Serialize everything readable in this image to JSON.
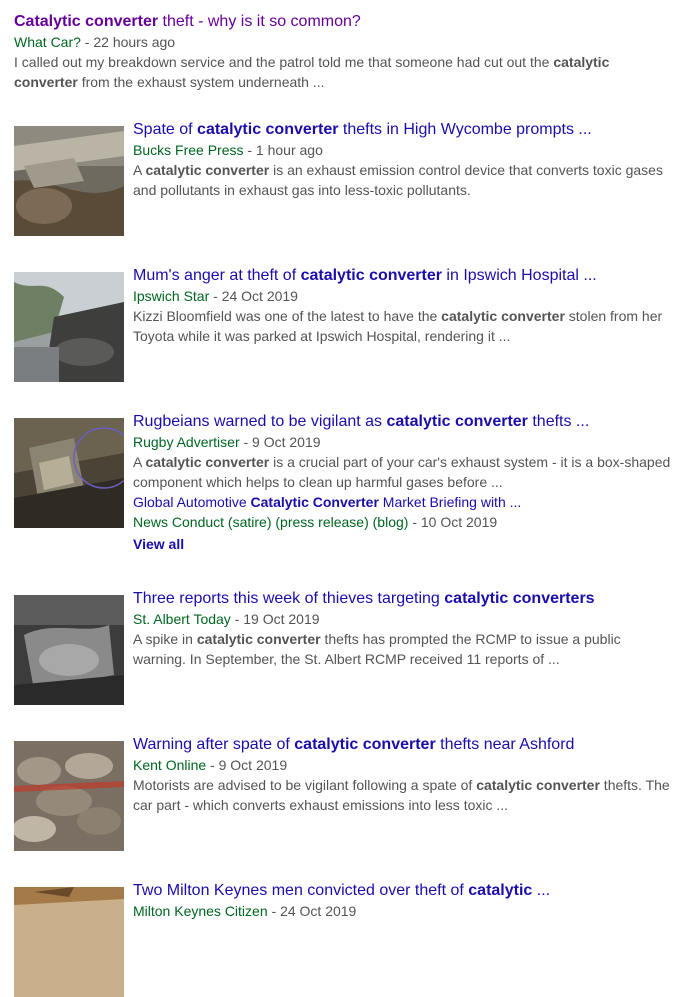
{
  "results": [
    {
      "title": [
        {
          "t": "Catalytic converter",
          "b": true
        },
        {
          "t": " theft - why is it so common?",
          "b": false
        }
      ],
      "source": "What Car?",
      "time": " - 22 hours ago",
      "snippet": [
        {
          "t": "I called out my breakdown service and the patrol told me that someone had cut out the ",
          "b": false
        },
        {
          "t": "catalytic converter",
          "b": true
        },
        {
          "t": " from the exhaust system underneath ...",
          "b": false
        }
      ],
      "thumbnail": ""
    },
    {
      "title": [
        {
          "t": "Spate of ",
          "b": false
        },
        {
          "t": "catalytic converter",
          "b": true
        },
        {
          "t": " thefts in High Wycombe prompts ...",
          "b": false
        }
      ],
      "source": "Bucks Free Press",
      "time": " - 1 hour ago",
      "snippet": [
        {
          "t": "A ",
          "b": false
        },
        {
          "t": "catalytic converter",
          "b": true
        },
        {
          "t": " is an exhaust emission control device that converts toxic gases and pollutants in exhaust gas into less-toxic pollutants.",
          "b": false
        }
      ],
      "thumbnail": "exhaust-pipe-photo"
    },
    {
      "title": [
        {
          "t": "Mum's anger at theft of ",
          "b": false
        },
        {
          "t": "catalytic converter",
          "b": true
        },
        {
          "t": " in Ipswich Hospital ...",
          "b": false
        }
      ],
      "source": "Ipswich Star",
      "time": " - 24 Oct 2019",
      "snippet": [
        {
          "t": "Kizzi Bloomfield was one of the latest to have the ",
          "b": false
        },
        {
          "t": "catalytic converter",
          "b": true
        },
        {
          "t": " stolen from her Toyota while it was parked at Ipswich Hospital, rendering it ...",
          "b": false
        }
      ],
      "thumbnail": "car-underside-photo"
    },
    {
      "title": [
        {
          "t": "Rugbeians warned to be vigilant as ",
          "b": false
        },
        {
          "t": "catalytic converter",
          "b": true
        },
        {
          "t": " thefts ...",
          "b": false
        }
      ],
      "source": "Rugby Advertiser",
      "time": " - 9 Oct 2019",
      "snippet": [
        {
          "t": "A ",
          "b": false
        },
        {
          "t": "catalytic converter",
          "b": true
        },
        {
          "t": " is a crucial part of your car's exhaust system - it is a box-shaped component which helps to clean up harmful gases before ...",
          "b": false
        }
      ],
      "thumbnail": "converter-closeup-photo",
      "related": {
        "title": [
          {
            "t": "Global Automotive ",
            "b": false
          },
          {
            "t": "Catalytic Converter",
            "b": true
          },
          {
            "t": " Market Briefing with ...",
            "b": false
          }
        ],
        "source": "News Conduct (satire) (press release) (blog)",
        "time": " - 10 Oct 2019"
      },
      "view_all": "View all"
    },
    {
      "title": [
        {
          "t": "Three reports this week of thieves targeting ",
          "b": false
        },
        {
          "t": "catalytic converters",
          "b": true
        }
      ],
      "source": "St. Albert Today",
      "time": " - 19 Oct 2019",
      "snippet": [
        {
          "t": "A spike in ",
          "b": false
        },
        {
          "t": "catalytic converter",
          "b": true
        },
        {
          "t": " thefts has prompted the RCMP to issue a public warning. In September, the St. Albert RCMP received 11 reports of ...",
          "b": false
        }
      ],
      "thumbnail": "security-camera-photo"
    },
    {
      "title": [
        {
          "t": "Warning after spate of ",
          "b": false
        },
        {
          "t": "catalytic converter",
          "b": true
        },
        {
          "t": " thefts near Ashford",
          "b": false
        }
      ],
      "source": "Kent Online",
      "time": " - 9 Oct 2019",
      "snippet": [
        {
          "t": "Motorists are advised to be vigilant following a spate of ",
          "b": false
        },
        {
          "t": "catalytic converter",
          "b": true
        },
        {
          "t": " thefts. The car part - which converts exhaust emissions into less toxic ...",
          "b": false
        }
      ],
      "thumbnail": "scrap-pile-photo"
    },
    {
      "title": [
        {
          "t": "Two Milton Keynes men convicted over theft of ",
          "b": false
        },
        {
          "t": "catalytic",
          "b": true
        },
        {
          "t": " ...",
          "b": false
        }
      ],
      "source": "Milton Keynes Citizen",
      "time": " - 24 Oct 2019",
      "snippet": [],
      "thumbnail": "sky-photo"
    }
  ]
}
